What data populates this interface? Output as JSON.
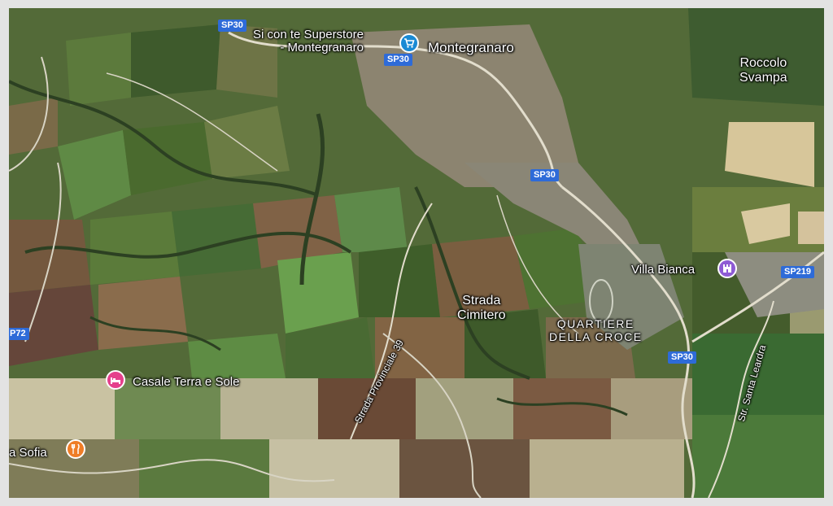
{
  "map": {
    "places": {
      "montegranaro": "Montegranaro",
      "roccolo": "Roccolo\nSvampa",
      "strada_cimitero": "Strada\nCimitero",
      "quartiere": "QUARTIERE\nDELLA CROCE"
    },
    "pois": {
      "superstore": "Si con te Superstore\n- Montegranaro",
      "villa_bianca": "Villa Bianca",
      "casale": "Casale Terra e Sole",
      "sofia": "a Sofia"
    },
    "roads": {
      "sp30_a": "SP30",
      "sp30_b": "SP30",
      "sp30_c": "SP30",
      "sp30_d": "SP30",
      "sp219": "SP219",
      "p72": "P72",
      "strada_provinciale": "Strada Provinciale 39",
      "str_santa": "Str. Santa Leardra"
    },
    "colors": {
      "shield": "#2e6bd8",
      "shopping_pin": "#1a8ad4",
      "lodging_pin": "#e5408c",
      "restaurant_pin": "#ef7d26",
      "landmark_pin": "#8e5bd4"
    },
    "icons": {
      "superstore": "shopping-cart-icon",
      "villa_bianca": "landmark-icon",
      "casale": "bed-icon",
      "sofia": "fork-knife-icon"
    }
  }
}
